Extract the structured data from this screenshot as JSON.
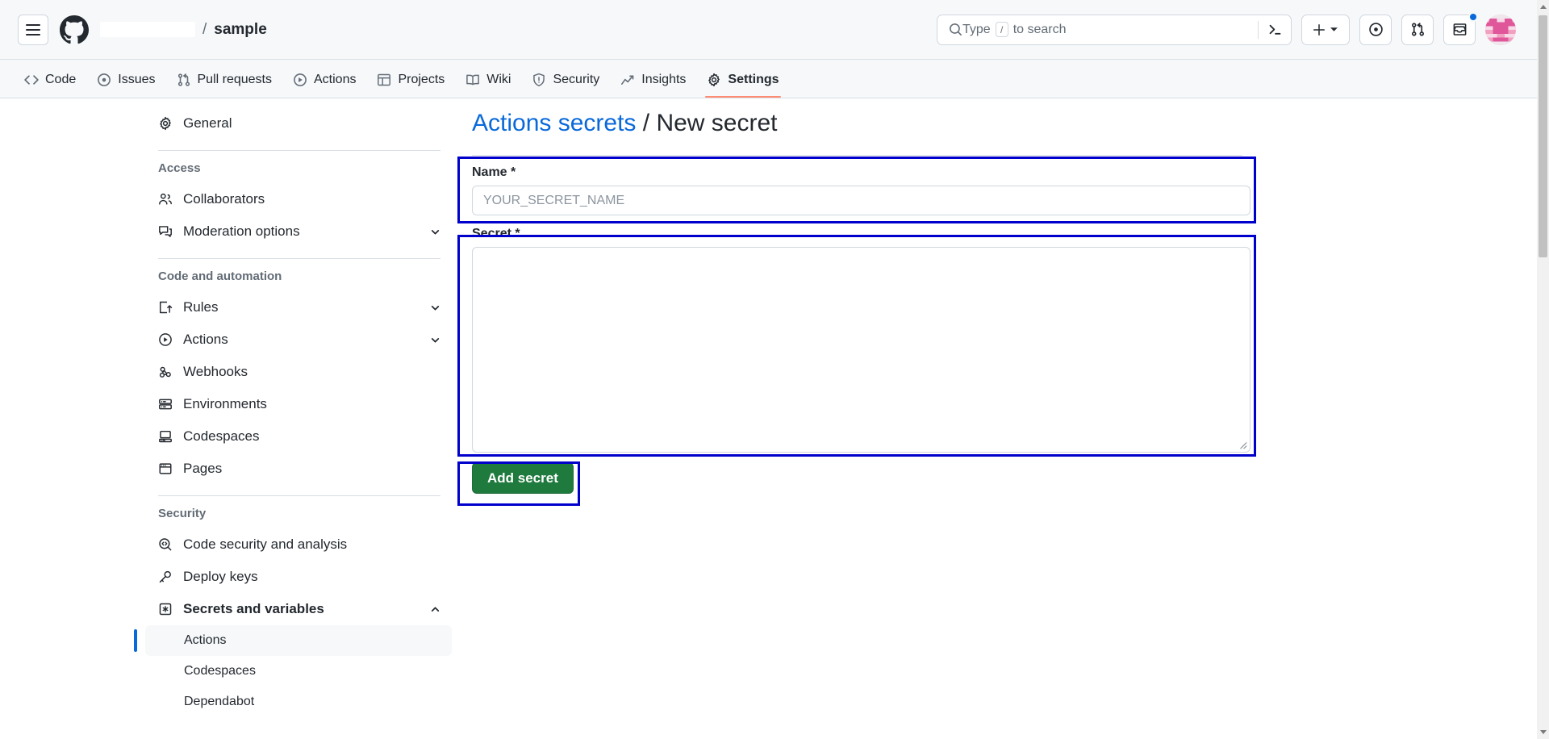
{
  "header": {
    "menu_icon": "hamburger-menu-icon",
    "logo_icon": "github-logo-icon",
    "owner_redacted": "",
    "breadcrumb_separator": "/",
    "repo_name": "sample",
    "search": {
      "placeholder_prefix": "Type",
      "shortcut_key": "/",
      "placeholder_suffix": "to search",
      "command_palette_icon": "terminal-icon"
    },
    "actions": {
      "create_new_icon": "plus-icon",
      "create_new_caret_icon": "chevron-down-icon",
      "issues_icon": "issue-opened-icon",
      "pull_requests_icon": "git-pull-request-icon",
      "notifications_icon": "inbox-icon",
      "notifications_unread": true,
      "avatar_icon": "user-avatar"
    }
  },
  "repo_nav": {
    "tabs": [
      {
        "label": "Code",
        "icon": "code-icon",
        "active": false
      },
      {
        "label": "Issues",
        "icon": "issue-opened-icon",
        "active": false
      },
      {
        "label": "Pull requests",
        "icon": "git-pull-request-icon",
        "active": false
      },
      {
        "label": "Actions",
        "icon": "play-circle-icon",
        "active": false
      },
      {
        "label": "Projects",
        "icon": "table-icon",
        "active": false
      },
      {
        "label": "Wiki",
        "icon": "book-icon",
        "active": false
      },
      {
        "label": "Security",
        "icon": "shield-icon",
        "active": false
      },
      {
        "label": "Insights",
        "icon": "graph-icon",
        "active": false
      },
      {
        "label": "Settings",
        "icon": "gear-icon",
        "active": true
      }
    ]
  },
  "sidebar": {
    "general": {
      "label": "General",
      "icon": "gear-icon"
    },
    "sections": [
      {
        "title": "Access",
        "items": [
          {
            "label": "Collaborators",
            "icon": "people-icon",
            "expandable": false
          },
          {
            "label": "Moderation options",
            "icon": "comment-discussion-icon",
            "expandable": false
          }
        ]
      },
      {
        "title": "Code and automation",
        "items": [
          {
            "label": "Rules",
            "icon": "rules-icon",
            "expandable": true
          },
          {
            "label": "Actions",
            "icon": "play-circle-icon",
            "expandable": true
          },
          {
            "label": "Webhooks",
            "icon": "webhook-icon",
            "expandable": false
          },
          {
            "label": "Environments",
            "icon": "server-icon",
            "expandable": false
          },
          {
            "label": "Codespaces",
            "icon": "codespaces-icon",
            "expandable": false
          },
          {
            "label": "Pages",
            "icon": "browser-icon",
            "expandable": false
          }
        ]
      },
      {
        "title": "Security",
        "items": [
          {
            "label": "Code security and analysis",
            "icon": "codescan-icon",
            "expandable": false
          },
          {
            "label": "Deploy keys",
            "icon": "key-icon",
            "expandable": false
          },
          {
            "label": "Secrets and variables",
            "icon": "key-asterisk-icon",
            "expandable": true,
            "expanded": true,
            "bold": true
          }
        ],
        "subitems": [
          {
            "label": "Actions",
            "selected": true
          },
          {
            "label": "Codespaces",
            "selected": false
          },
          {
            "label": "Dependabot",
            "selected": false
          }
        ]
      }
    ]
  },
  "main": {
    "title_link": "Actions secrets",
    "title_separator": "/",
    "title_current": "New secret",
    "name_field": {
      "label": "Name *",
      "placeholder": "YOUR_SECRET_NAME",
      "value": ""
    },
    "secret_field": {
      "label": "Secret *",
      "placeholder": "",
      "value": "",
      "resize_icon": "resize-grip-icon"
    },
    "submit_label": "Add secret"
  },
  "annotations": {
    "color": "#0000cc",
    "boxes": [
      "name-field-highlight",
      "secret-field-highlight",
      "add-secret-button-highlight"
    ]
  },
  "scrollbar": {
    "up_icon": "scroll-up-arrow-icon",
    "down_icon": "scroll-down-arrow-icon"
  },
  "colors": {
    "accent_blue": "#0969da",
    "green_button": "#1f7a3d",
    "active_tab_underline": "#fd8c73",
    "header_bg": "#f6f8fa"
  }
}
